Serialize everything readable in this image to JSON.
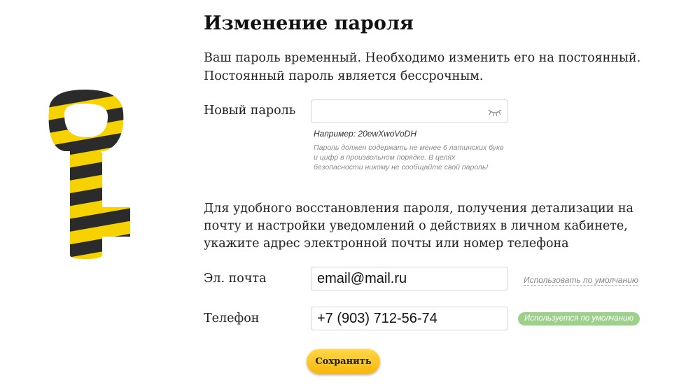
{
  "page": {
    "title": "Изменение пароля",
    "intro": "Ваш пароль временный. Необходимо изменить его на постоянный. Постоянный пароль является бессрочным."
  },
  "new_password": {
    "label": "Новый пароль",
    "value": "",
    "visibility_icon": "closed-eye-icon",
    "example": "Например: 20ewXwoVoDH",
    "hint": "Пароль должен содержать не менее 6 латинских букв и цифр в произвольном порядке. В целях безопасности никому не сообщайте свой пароль!"
  },
  "recovery": {
    "text": "Для удобного восстановления пароля, получения детализации на почту и настройки уведомлений о действиях в личном кабинете, укажите адрес электронной почты или номер телефона"
  },
  "email": {
    "label": "Эл. почта",
    "value": "email@mail.ru",
    "default_link": "Использовать по умолчанию"
  },
  "phone": {
    "label": "Телефон",
    "value": "+7 (903) 712-56-74",
    "default_badge": "Используется по умолчанию"
  },
  "actions": {
    "save_label": "Сохранить"
  },
  "colors": {
    "brand_yellow": "#f5d200",
    "brand_black": "#2b2b2b",
    "button_yellow": "#f6b70a",
    "badge_green": "#9cd08b"
  }
}
